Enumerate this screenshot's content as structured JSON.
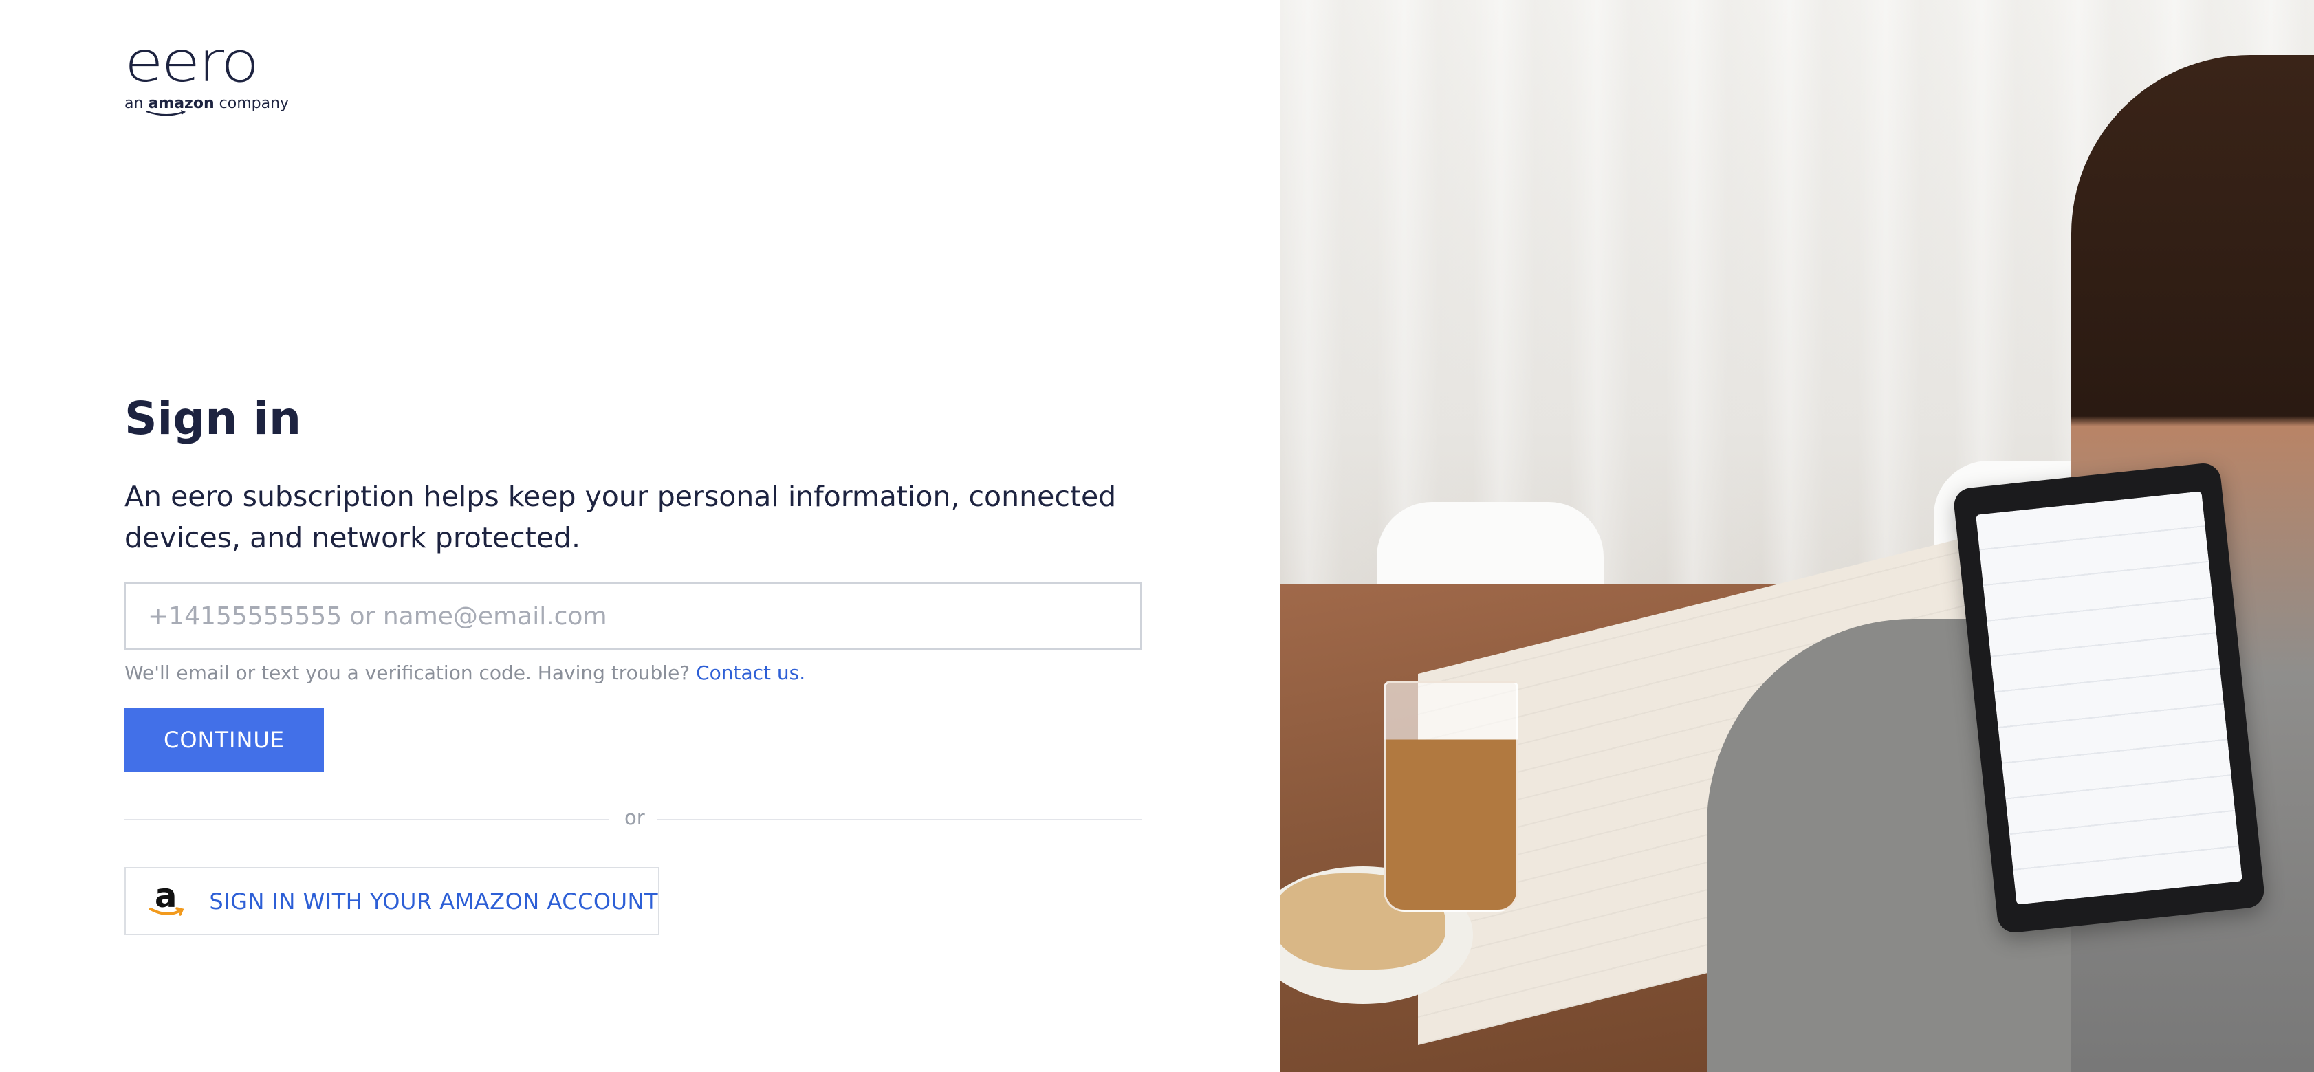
{
  "brand": {
    "wordmark": "eero",
    "tagline_prefix": "an",
    "tagline_brand": "amazon",
    "tagline_suffix": "company"
  },
  "signin": {
    "title": "Sign in",
    "description": "An eero subscription helps keep your personal information, connected devices, and network protected.",
    "input_placeholder": "+14155555555 or name@email.com",
    "input_value": "",
    "helper_text": "We'll email or text you a verification code. Having trouble? ",
    "contact_link": "Contact us.",
    "continue_label": "CONTINUE",
    "divider_text": "or",
    "amazon_button_label": "SIGN IN WITH YOUR AMAZON ACCOUNT"
  },
  "colors": {
    "primary": "#4270e8",
    "link": "#2d5fd6",
    "text": "#1d2340"
  },
  "icons": {
    "amazon": "amazon-logo-icon"
  }
}
